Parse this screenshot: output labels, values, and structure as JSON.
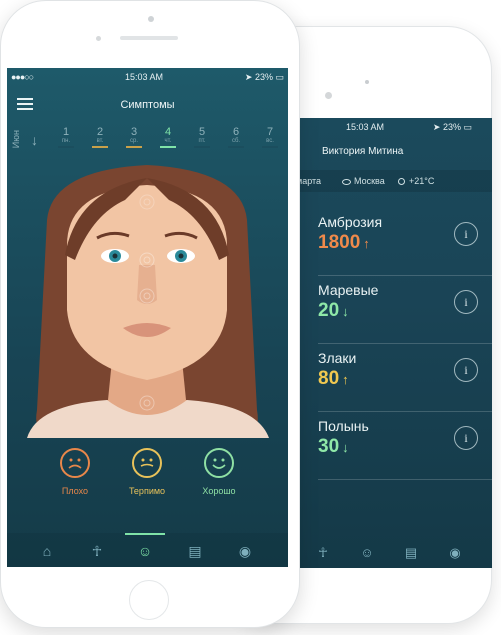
{
  "front_phone": {
    "status": {
      "signal": "●●●○○",
      "time": "15:03 AM",
      "battery": "23%"
    },
    "header": {
      "title": "Симптомы"
    },
    "days": {
      "month": "Июн",
      "items": [
        {
          "num": "1",
          "dow": "пн."
        },
        {
          "num": "2",
          "dow": "вт."
        },
        {
          "num": "3",
          "dow": "ср."
        },
        {
          "num": "4",
          "dow": "чт."
        },
        {
          "num": "5",
          "dow": "пт."
        },
        {
          "num": "6",
          "dow": "сб."
        },
        {
          "num": "7",
          "dow": "вс."
        }
      ],
      "active_index": 3,
      "bar_colors": [
        "#1b4e5e",
        "#c9a14a",
        "#c9a14a",
        "#7fe3a8",
        "#1b4e5e",
        "#1b4e5e",
        "#1b4e5e"
      ]
    },
    "ratings": [
      {
        "label": "Плохо",
        "color": "#e8874a"
      },
      {
        "label": "Терпимо",
        "color": "#e8c25a"
      },
      {
        "label": "Хорошо",
        "color": "#8fe0a4"
      }
    ],
    "nav": [
      "home-icon",
      "person-icon",
      "face-icon",
      "chat-icon",
      "location-icon"
    ]
  },
  "back_phone": {
    "status": {
      "time": "15:03 AM",
      "battery": "23%"
    },
    "user_name": "Виктория Митина",
    "subbar": {
      "date": "марта",
      "city": "Москва",
      "temp": "+21°C"
    },
    "pollen": [
      {
        "name": "Амброзия",
        "value": "1800",
        "trend": "up",
        "color": "#f08a4b"
      },
      {
        "name": "Маревые",
        "value": "20",
        "trend": "down",
        "color": "#8fe8a8"
      },
      {
        "name": "Злаки",
        "value": "80",
        "trend": "up",
        "color": "#f0c850"
      },
      {
        "name": "Полынь",
        "value": "30",
        "trend": "down",
        "color": "#8fe8a8"
      }
    ],
    "nav": [
      "person-icon",
      "face-icon",
      "chat-icon",
      "location-icon"
    ]
  }
}
